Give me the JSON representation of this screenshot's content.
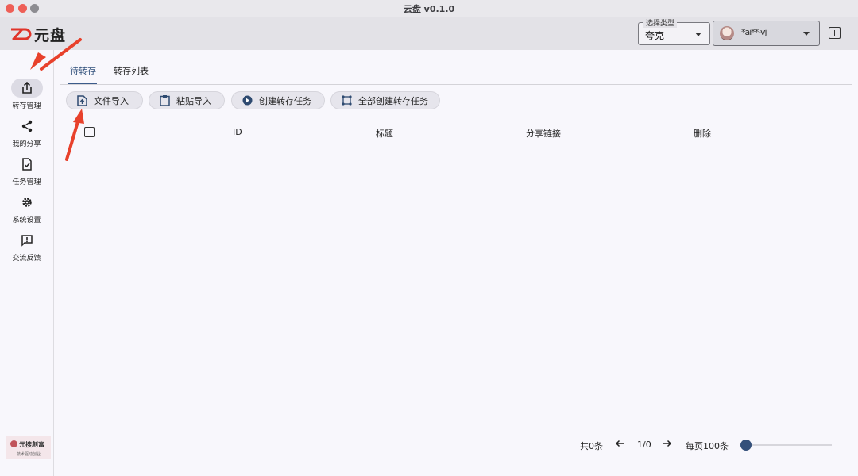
{
  "window": {
    "title": "云盘 v0.1.0"
  },
  "header": {
    "logo_text": "元盘",
    "drive_select": {
      "label": "选择类型",
      "value": "夸克"
    },
    "account": {
      "name": "*ai**-vj"
    }
  },
  "sidebar": {
    "items": [
      {
        "label": "转存管理",
        "icon": "upload-share-icon"
      },
      {
        "label": "我的分享",
        "icon": "share-icon"
      },
      {
        "label": "任务管理",
        "icon": "task-check-icon"
      },
      {
        "label": "系统设置",
        "icon": "gear-icon"
      },
      {
        "label": "交流反馈",
        "icon": "feedback-icon"
      }
    ],
    "brand": {
      "name": "元搜創富",
      "tagline": "技术驱动创业"
    }
  },
  "main": {
    "tabs": [
      {
        "label": "待转存"
      },
      {
        "label": "转存列表"
      }
    ],
    "toolbar": {
      "file_import": "文件导入",
      "paste_import": "粘贴导入",
      "create_task": "创建转存任务",
      "create_all_tasks": "全部创建转存任务"
    },
    "table": {
      "headers": [
        "ID",
        "标题",
        "分享链接",
        "删除"
      ]
    },
    "pagination": {
      "total": "共0条",
      "page": "1/0",
      "per_page": "每页100条"
    }
  },
  "colors": {
    "accent": "#34507a",
    "annotation_arrow": "#e8412c",
    "logo_red": "#e0342a"
  }
}
